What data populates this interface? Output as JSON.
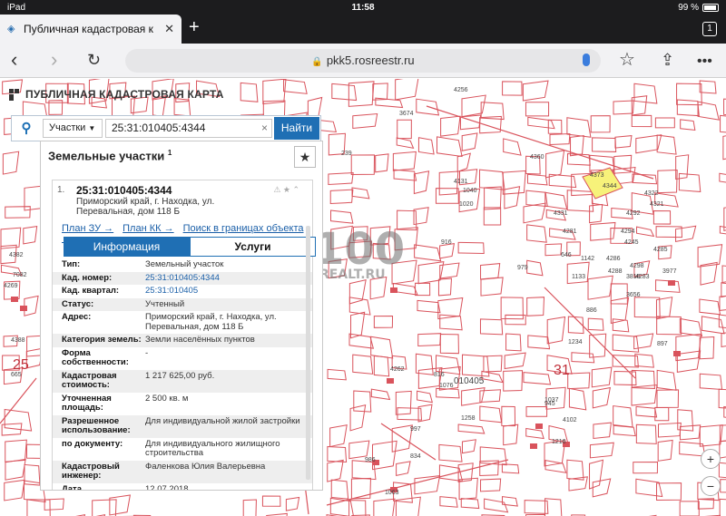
{
  "statusbar": {
    "device": "iPad",
    "time": "11:58",
    "battery": "99 %"
  },
  "tab": {
    "title": "Публичная кадастровая к",
    "count": "1"
  },
  "navbar": {
    "url": "pkk5.rosreestr.ru"
  },
  "app": {
    "title": "ПУБЛИЧНАЯ КАДАСТРОВАЯ КАРТА"
  },
  "search": {
    "type": "Участки",
    "value": "25:31:010405:4344",
    "button": "Найти"
  },
  "panel": {
    "title": "Земельные участки",
    "title_sup": "1",
    "card_num": "1.",
    "cad_number": "25:31:010405:4344",
    "address": "Приморский край, г. Находка, ул. Перевальная, дом 118 Б",
    "links": [
      "План ЗУ →",
      "План КК →",
      "Поиск в границах объекта →"
    ],
    "tab_info": "Информация",
    "tab_services": "Услуги",
    "rows": [
      {
        "k": "Тип:",
        "v": "Земельный участок"
      },
      {
        "k": "Кад. номер:",
        "v": "25:31:010405:4344"
      },
      {
        "k": "Кад. квартал:",
        "v": "25:31:010405"
      },
      {
        "k": "Статус:",
        "v": "Учтенный"
      },
      {
        "k": "Адрес:",
        "v": "Приморский край, г. Находка, ул. Перевальная, дом 118 Б"
      },
      {
        "k": "Категория земель:",
        "v": "Земли населённых пунктов"
      },
      {
        "k": "Форма собственности:",
        "v": "-"
      },
      {
        "k": "Кадастровая стоимость:",
        "v": "1 217 625,00 руб."
      },
      {
        "k": "Уточненная площадь:",
        "v": "2 500 кв. м"
      },
      {
        "k": "Разрешенное использование:",
        "v": "Для индивидуальной жилой застройки"
      },
      {
        "k": "по документу:",
        "v": "Для индивидуального жилищного строительства"
      },
      {
        "k": "Кадастровый инженер:",
        "v": "Фаленкова Юлия Валерьевна"
      },
      {
        "k": "Дата",
        "v": "12.07.2018"
      }
    ]
  },
  "map": {
    "labels": [
      "4256",
      "3674",
      "239",
      "4360",
      "4373",
      "4344",
      "4322",
      "4321",
      "4131",
      "1040",
      "1020",
      "4331",
      "4292",
      "4294",
      "4245",
      "4281",
      "4286",
      "4298",
      "4283",
      "1142",
      "4285",
      "4288",
      "916",
      "979",
      "1133",
      "646",
      "3977",
      "3656",
      "886",
      "3816",
      "1234",
      "897",
      "4262",
      "816",
      "1076",
      "010405",
      "31",
      "945",
      "1258",
      "1037",
      "4102",
      "1216",
      "834",
      "997",
      "986",
      "1063",
      "4382",
      "4269",
      "665",
      "7082",
      "4388",
      "25"
    ],
    "watermark": "100",
    "watermark_sub": "REALT.RU"
  },
  "colors": {
    "accent": "#1f6fb4",
    "map_line": "#d9535c"
  }
}
